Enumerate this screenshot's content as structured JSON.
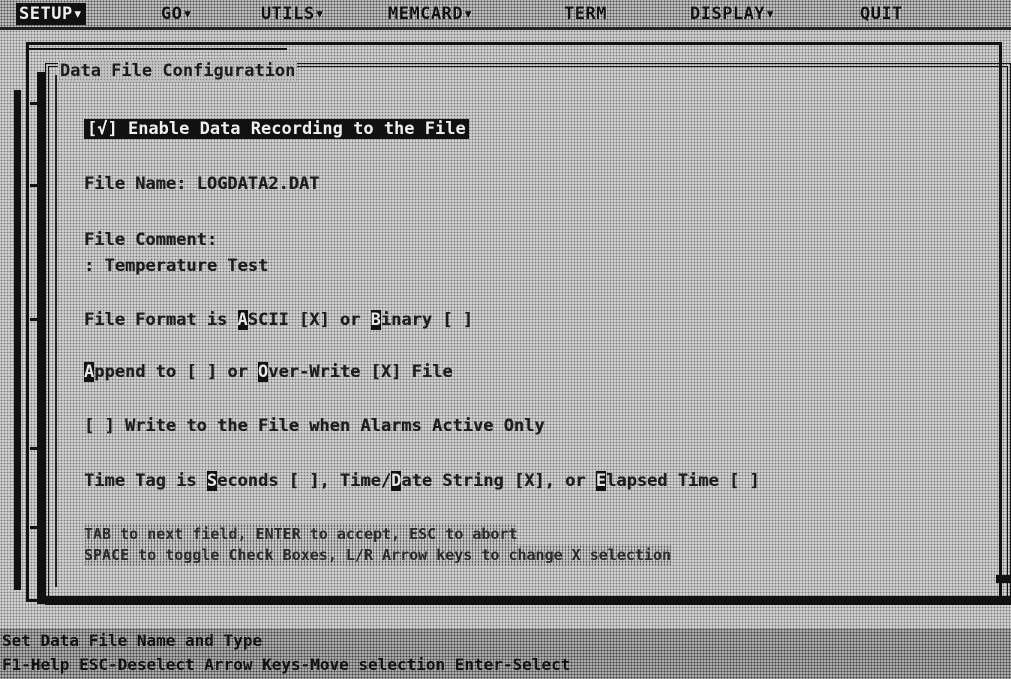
{
  "menu": [
    {
      "label": "SETUP▾",
      "active": true
    },
    {
      "label": "GO▾",
      "active": false
    },
    {
      "label": "UTILS▾",
      "active": false
    },
    {
      "label": "MEMCARD▾",
      "active": false
    },
    {
      "label": "TERM",
      "active": false
    },
    {
      "label": "DISPLAY▾",
      "active": false
    },
    {
      "label": "QUIT",
      "active": false
    }
  ],
  "dialog": {
    "title": "Data File Configuration",
    "enable_recording": {
      "box": "[√]",
      "label": " Enable Data Recording to the File"
    },
    "file_name": {
      "label": "File Name: ",
      "value": "LOGDATA2.DAT"
    },
    "file_comment": {
      "label": "File Comment:",
      "value": ": Temperature Test"
    },
    "file_format": {
      "prefix": "File Format is ",
      "ascii_hotkey": "A",
      "ascii_rest": "SCII ",
      "ascii_box": "[X]",
      "mid": " or ",
      "binary_hotkey": "B",
      "binary_rest": "inary ",
      "binary_box": "[ ]"
    },
    "append_mode": {
      "append_hotkey": "A",
      "append_rest": "ppend to ",
      "append_box": "[ ]",
      "mid": " or ",
      "overwrite_hotkey": "O",
      "overwrite_rest": "ver-Write ",
      "overwrite_box": "[X]",
      "suffix": " File"
    },
    "alarms_only": {
      "box": "[ ]",
      "label": " Write to the File when Alarms Active Only"
    },
    "time_tag": {
      "prefix": "Time Tag is ",
      "seconds_hotkey": "S",
      "seconds_rest": "econds ",
      "seconds_box": "[ ]",
      "sep1": ", Time/",
      "date_hotkey": "D",
      "date_rest": "ate String ",
      "date_box": "[X]",
      "sep2": ", or ",
      "elapsed_hotkey": "E",
      "elapsed_rest": "lapsed Time ",
      "elapsed_box": "[ ]"
    },
    "help": [
      "TAB to next field, ENTER to accept, ESC to abort",
      "SPACE to toggle Check Boxes, L/R Arrow keys to change X selection"
    ]
  },
  "status": {
    "line1": "Set Data File Name and Type",
    "line2": " F1-Help  ESC-Deselect  Arrow Keys-Move selection  Enter-Select"
  }
}
